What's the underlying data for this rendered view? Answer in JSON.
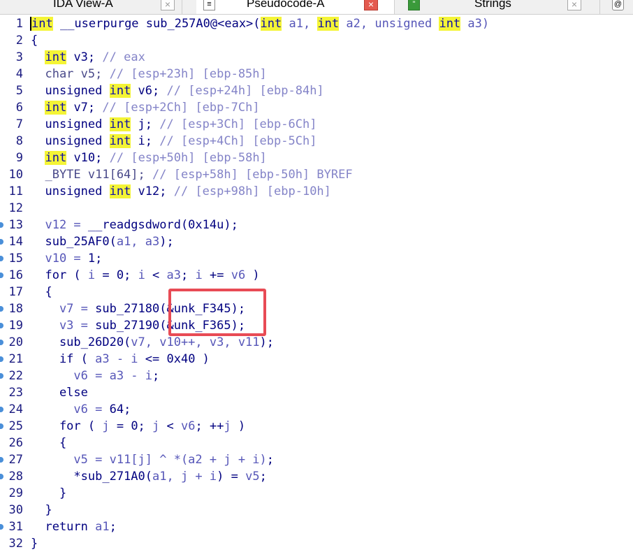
{
  "tabs": [
    {
      "label": "IDA View-A",
      "close": "×"
    },
    {
      "label": "Pseudocode-A",
      "close": "×",
      "active": true
    },
    {
      "label": "Strings",
      "close": "×",
      "icon": "\""
    },
    {
      "icon": "@"
    }
  ],
  "code": [
    {
      "n": "1",
      "t": [
        [
          "int",
          "hl"
        ],
        [
          " __userpurge sub_257A0@<eax>(",
          "fn"
        ],
        [
          "int",
          "hl"
        ],
        [
          " a1, ",
          "arg"
        ],
        [
          "int",
          "hl"
        ],
        [
          " a2, unsigned ",
          "arg"
        ],
        [
          "int",
          "hl"
        ],
        [
          " a3)",
          "arg"
        ]
      ]
    },
    {
      "n": "2",
      "t": [
        [
          "{",
          "kw"
        ]
      ]
    },
    {
      "n": "3",
      "t": [
        [
          "  ",
          ""
        ],
        [
          "int",
          "hl"
        ],
        [
          " v3; ",
          "var"
        ],
        [
          "// eax",
          "cm"
        ]
      ]
    },
    {
      "n": "4",
      "t": [
        [
          "  char v5; ",
          "ty"
        ],
        [
          "// [esp+23h] [ebp-85h]",
          "cm"
        ]
      ]
    },
    {
      "n": "5",
      "t": [
        [
          "  unsigned ",
          "kw"
        ],
        [
          "int",
          "hl"
        ],
        [
          " v6; ",
          "var"
        ],
        [
          "// [esp+24h] [ebp-84h]",
          "cm"
        ]
      ]
    },
    {
      "n": "6",
      "t": [
        [
          "  ",
          ""
        ],
        [
          "int",
          "hl"
        ],
        [
          " v7; ",
          "var"
        ],
        [
          "// [esp+2Ch] [ebp-7Ch]",
          "cm"
        ]
      ]
    },
    {
      "n": "7",
      "t": [
        [
          "  unsigned ",
          "kw"
        ],
        [
          "int",
          "hl"
        ],
        [
          " j; ",
          "var"
        ],
        [
          "// [esp+3Ch] [ebp-6Ch]",
          "cm"
        ]
      ]
    },
    {
      "n": "8",
      "t": [
        [
          "  unsigned ",
          "kw"
        ],
        [
          "int",
          "hl"
        ],
        [
          " i; ",
          "var"
        ],
        [
          "// [esp+4Ch] [ebp-5Ch]",
          "cm"
        ]
      ]
    },
    {
      "n": "9",
      "t": [
        [
          "  ",
          ""
        ],
        [
          "int",
          "hl"
        ],
        [
          " v10; ",
          "var"
        ],
        [
          "// [esp+50h] [ebp-58h]",
          "cm"
        ]
      ]
    },
    {
      "n": "10",
      "t": [
        [
          "  _BYTE v11[64]; ",
          "ty"
        ],
        [
          "// [esp+58h] [ebp-50h] BYREF",
          "cm"
        ]
      ]
    },
    {
      "n": "11",
      "t": [
        [
          "  unsigned ",
          "kw"
        ],
        [
          "int",
          "hl"
        ],
        [
          " v12; ",
          "var"
        ],
        [
          "// [esp+98h] [ebp-10h]",
          "cm"
        ]
      ]
    },
    {
      "n": "12",
      "t": []
    },
    {
      "n": "13",
      "bp": true,
      "t": [
        [
          "  v12 = ",
          "arg"
        ],
        [
          "__readgsdword(0x14u);",
          "fn"
        ]
      ]
    },
    {
      "n": "14",
      "bp": true,
      "t": [
        [
          "  sub_25AF0(",
          "fn"
        ],
        [
          "a1, a3",
          "arg"
        ],
        [
          ");",
          "fn"
        ]
      ]
    },
    {
      "n": "15",
      "bp": true,
      "t": [
        [
          "  v10 = ",
          "arg"
        ],
        [
          "1;",
          "num"
        ]
      ]
    },
    {
      "n": "16",
      "bp": true,
      "t": [
        [
          "  for ( ",
          "kw"
        ],
        [
          "i",
          "arg"
        ],
        [
          " = 0; ",
          "kw"
        ],
        [
          "i",
          "arg"
        ],
        [
          " < ",
          "kw"
        ],
        [
          "a3",
          "arg"
        ],
        [
          "; ",
          "kw"
        ],
        [
          "i",
          "arg"
        ],
        [
          " += ",
          "kw"
        ],
        [
          "v6",
          "arg"
        ],
        [
          " )",
          "kw"
        ]
      ]
    },
    {
      "n": "17",
      "t": [
        [
          "  {",
          "kw"
        ]
      ]
    },
    {
      "n": "18",
      "bp": true,
      "t": [
        [
          "    v7 = ",
          "arg"
        ],
        [
          "sub_27180(&unk_F345);",
          "fn"
        ]
      ]
    },
    {
      "n": "19",
      "bp": true,
      "t": [
        [
          "    v3 = ",
          "arg"
        ],
        [
          "sub_27190(&unk_F365);",
          "fn"
        ]
      ]
    },
    {
      "n": "20",
      "bp": true,
      "t": [
        [
          "    sub_26D20(",
          "fn"
        ],
        [
          "v7, v10++, v3, v11",
          "arg"
        ],
        [
          ");",
          "fn"
        ]
      ]
    },
    {
      "n": "21",
      "bp": true,
      "t": [
        [
          "    if ( ",
          "kw"
        ],
        [
          "a3 - i",
          "arg"
        ],
        [
          " <= 0x40 )",
          "kw"
        ]
      ]
    },
    {
      "n": "22",
      "bp": true,
      "t": [
        [
          "      v6 = ",
          "arg"
        ],
        [
          "a3 - i",
          "arg"
        ],
        [
          ";",
          "kw"
        ]
      ]
    },
    {
      "n": "23",
      "t": [
        [
          "    else",
          "kw"
        ]
      ]
    },
    {
      "n": "24",
      "bp": true,
      "t": [
        [
          "      v6 = ",
          "arg"
        ],
        [
          "64;",
          "num"
        ]
      ]
    },
    {
      "n": "25",
      "bp": true,
      "t": [
        [
          "    for ( ",
          "kw"
        ],
        [
          "j",
          "arg"
        ],
        [
          " = 0; ",
          "kw"
        ],
        [
          "j",
          "arg"
        ],
        [
          " < ",
          "kw"
        ],
        [
          "v6",
          "arg"
        ],
        [
          "; ++",
          "kw"
        ],
        [
          "j",
          "arg"
        ],
        [
          " )",
          "kw"
        ]
      ]
    },
    {
      "n": "26",
      "t": [
        [
          "    {",
          "kw"
        ]
      ]
    },
    {
      "n": "27",
      "bp": true,
      "t": [
        [
          "      v5 = ",
          "arg"
        ],
        [
          "v11[j] ^ *(a2 + j + i)",
          "arg"
        ],
        [
          ";",
          "kw"
        ]
      ]
    },
    {
      "n": "28",
      "bp": true,
      "t": [
        [
          "      *sub_271A0(",
          "fn"
        ],
        [
          "a1, j + i",
          "arg"
        ],
        [
          ") = ",
          "fn"
        ],
        [
          "v5",
          "arg"
        ],
        [
          ";",
          "kw"
        ]
      ]
    },
    {
      "n": "29",
      "t": [
        [
          "    }",
          "kw"
        ]
      ]
    },
    {
      "n": "30",
      "t": [
        [
          "  }",
          "kw"
        ]
      ]
    },
    {
      "n": "31",
      "bp": true,
      "t": [
        [
          "  return ",
          "kw"
        ],
        [
          "a1",
          "arg"
        ],
        [
          ";",
          "kw"
        ]
      ]
    },
    {
      "n": "32",
      "t": [
        [
          "}",
          "kw"
        ]
      ]
    }
  ]
}
